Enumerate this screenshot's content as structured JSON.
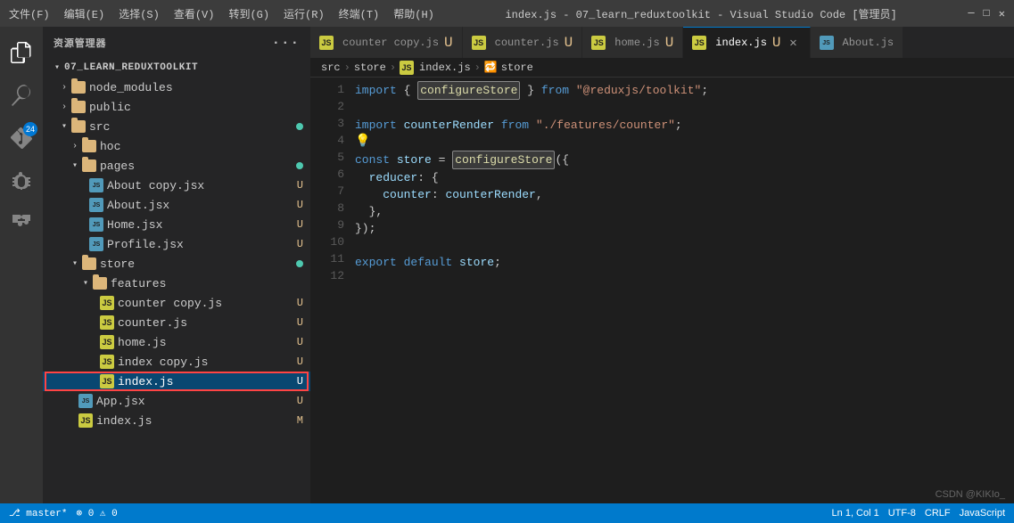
{
  "titleBar": {
    "menus": [
      "文件(F)",
      "编辑(E)",
      "选择(S)",
      "查看(V)",
      "转到(G)",
      "运行(R)",
      "终端(T)",
      "帮助(H)"
    ],
    "title": "index.js - 07_learn_reduxtoolkit - Visual Studio Code [管理员]"
  },
  "sidebar": {
    "header": "资源管理器",
    "project": "07_LEARN_REDUXTOOLKIT",
    "items": [
      {
        "label": "node_modules",
        "type": "folder",
        "indent": 1,
        "collapsed": true
      },
      {
        "label": "public",
        "type": "folder",
        "indent": 1,
        "collapsed": true
      },
      {
        "label": "src",
        "type": "folder",
        "indent": 1,
        "collapsed": false,
        "dot": true
      },
      {
        "label": "hoc",
        "type": "folder",
        "indent": 2,
        "collapsed": true
      },
      {
        "label": "pages",
        "type": "folder",
        "indent": 2,
        "collapsed": false,
        "dot": true
      },
      {
        "label": "About copy.jsx",
        "type": "jsx",
        "indent": 3,
        "badge": "U"
      },
      {
        "label": "About.jsx",
        "type": "jsx",
        "indent": 3,
        "badge": "U"
      },
      {
        "label": "Home.jsx",
        "type": "jsx",
        "indent": 3,
        "badge": "U"
      },
      {
        "label": "Profile.jsx",
        "type": "jsx",
        "indent": 3,
        "badge": "U"
      },
      {
        "label": "store",
        "type": "folder",
        "indent": 2,
        "collapsed": false,
        "dot": true
      },
      {
        "label": "features",
        "type": "folder",
        "indent": 3,
        "collapsed": false
      },
      {
        "label": "counter copy.js",
        "type": "js",
        "indent": 4,
        "badge": "U"
      },
      {
        "label": "counter.js",
        "type": "js",
        "indent": 4,
        "badge": "U"
      },
      {
        "label": "home.js",
        "type": "js",
        "indent": 4,
        "badge": "U"
      },
      {
        "label": "index copy.js",
        "type": "js",
        "indent": 4,
        "badge": "U"
      },
      {
        "label": "index.js",
        "type": "js",
        "indent": 4,
        "badge": "U",
        "active": true
      },
      {
        "label": "App.jsx",
        "type": "jsx",
        "indent": 2,
        "badge": "U"
      },
      {
        "label": "index.js",
        "type": "js",
        "indent": 2,
        "badge": "M"
      }
    ]
  },
  "tabs": [
    {
      "label": "counter copy.js",
      "type": "js",
      "modified": true,
      "active": false
    },
    {
      "label": "counter.js",
      "type": "js",
      "modified": true,
      "active": false
    },
    {
      "label": "home.js",
      "type": "js",
      "modified": true,
      "active": false
    },
    {
      "label": "index.js",
      "type": "js",
      "modified": true,
      "active": true,
      "closable": true
    },
    {
      "label": "About.js",
      "type": "jsx",
      "active": false
    }
  ],
  "breadcrumb": [
    "src",
    ">",
    "store",
    ">",
    "JS",
    "index.js",
    ">",
    "🔁",
    "store"
  ],
  "codeLines": [
    {
      "num": 1,
      "content": "import { configureStore } from \"@reduxjs/toolkit\";"
    },
    {
      "num": 2,
      "content": ""
    },
    {
      "num": 3,
      "content": "import counterRender from \"./features/counter\";"
    },
    {
      "num": 4,
      "content": "💡"
    },
    {
      "num": 5,
      "content": "const store = configureStore({"
    },
    {
      "num": 6,
      "content": "  reducer: {"
    },
    {
      "num": 7,
      "content": "    counter: counterRender,"
    },
    {
      "num": 8,
      "content": "  },"
    },
    {
      "num": 9,
      "content": "});"
    },
    {
      "num": 10,
      "content": ""
    },
    {
      "num": 11,
      "content": "export default store;"
    },
    {
      "num": 12,
      "content": ""
    }
  ],
  "statusBar": {
    "left": [
      "⎇ master*"
    ],
    "right": [
      "CSDN @KIKIo_"
    ]
  }
}
